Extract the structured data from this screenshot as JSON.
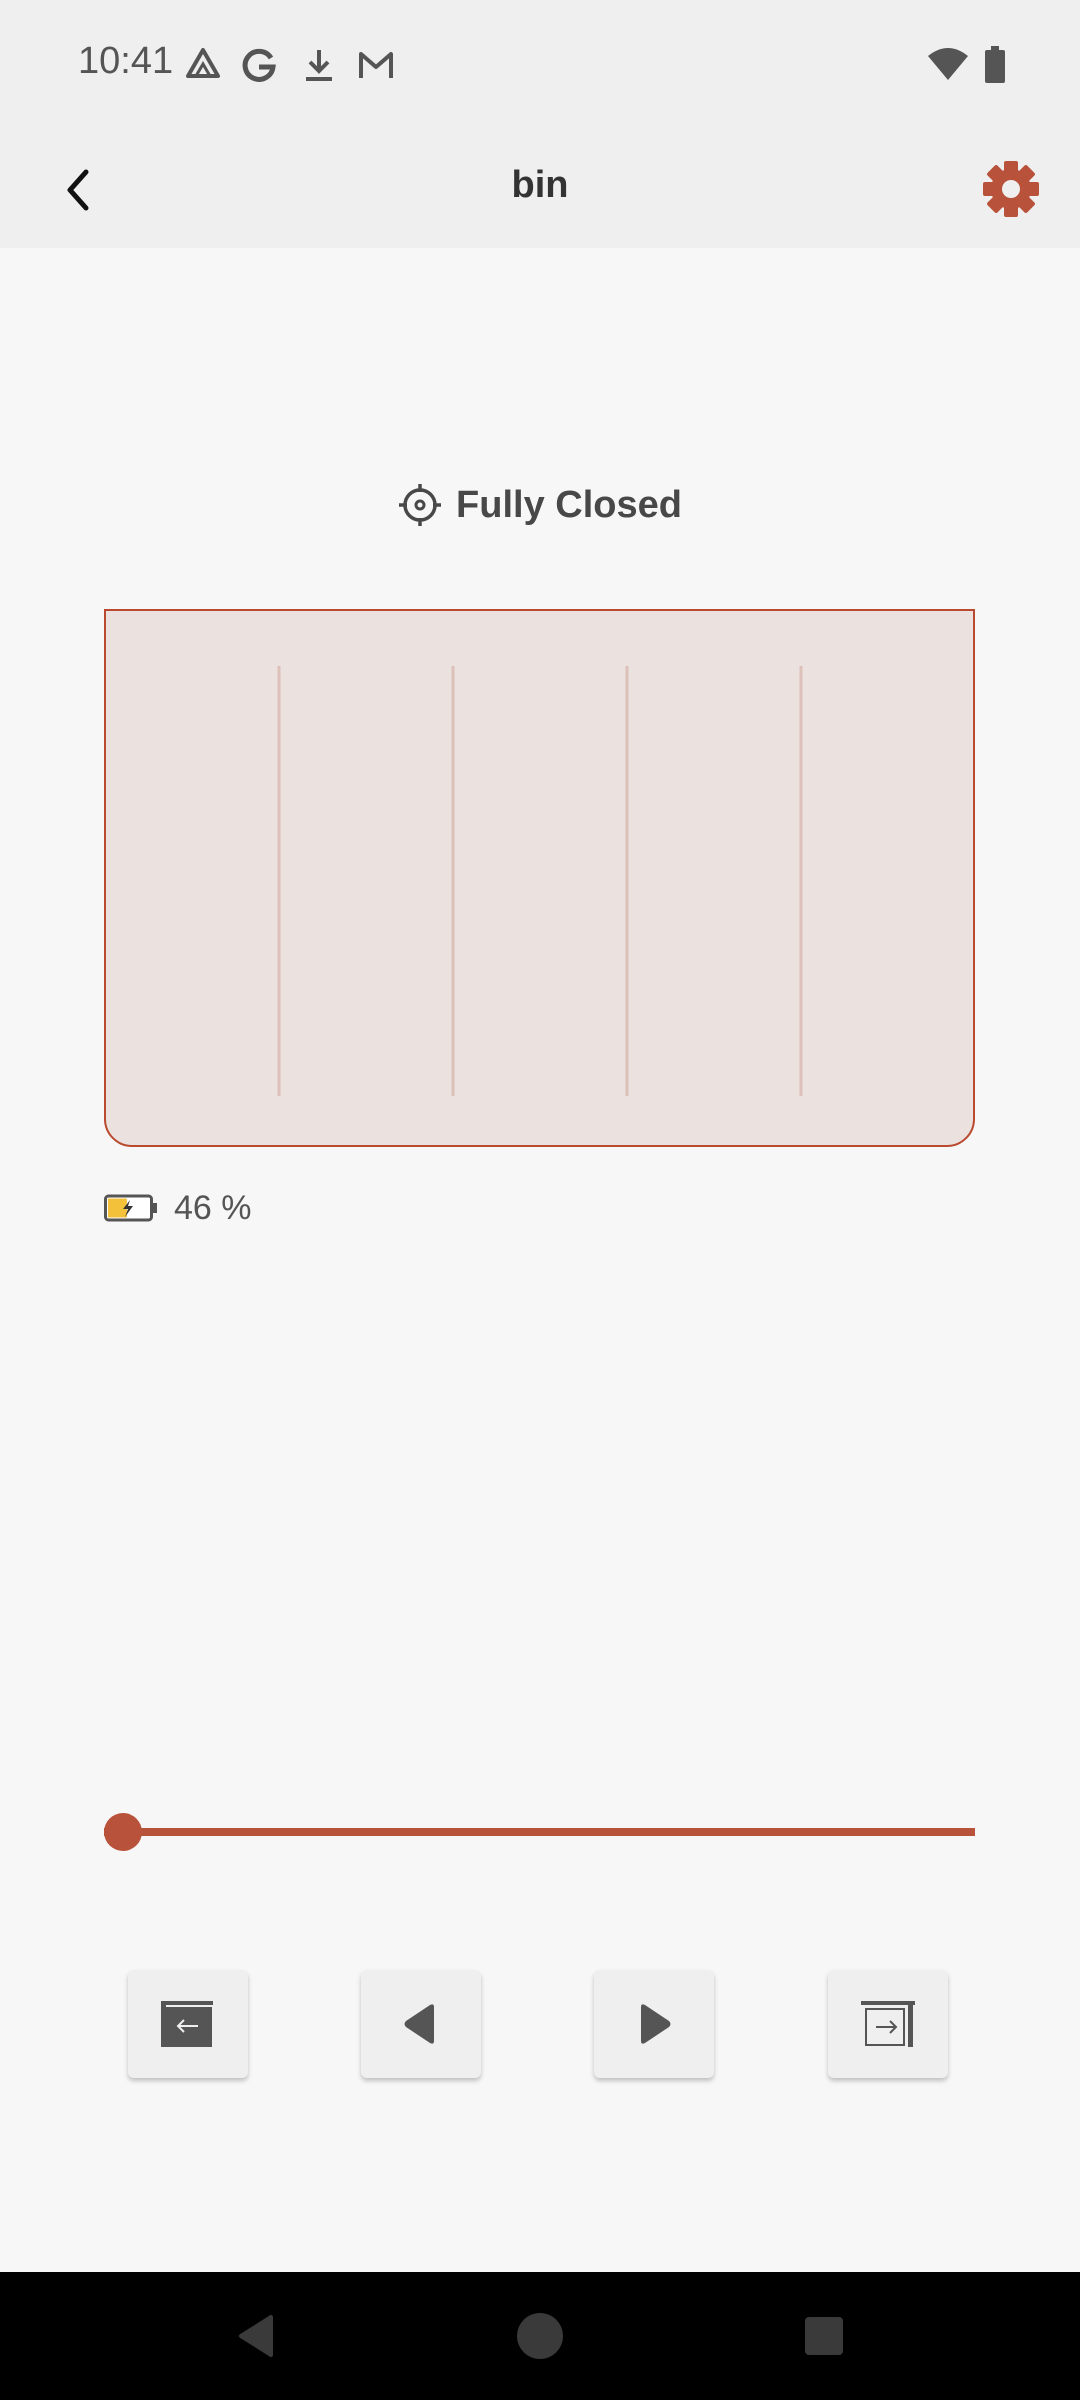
{
  "status_bar": {
    "time": "10:41",
    "notification_icons": [
      "drive-icon",
      "google-icon",
      "download-icon",
      "gmail-icon"
    ],
    "system_icons": [
      "wifi-icon",
      "battery-icon"
    ]
  },
  "app_bar": {
    "title": "bin",
    "back_icon": "back-arrow-icon",
    "settings_icon": "gear-icon",
    "accent_color": "#b9523a"
  },
  "device": {
    "state_icon": "position-target-icon",
    "state": "Fully Closed",
    "battery_icon": "battery-charging-icon",
    "battery_percent": 46,
    "battery_label": "46 %",
    "position_fraction": 0.0
  },
  "controls": [
    {
      "name": "fully-open-button",
      "icon": "curtain-open-left-icon"
    },
    {
      "name": "move-left-button",
      "icon": "triangle-left-icon"
    },
    {
      "name": "move-right-button",
      "icon": "triangle-right-icon"
    },
    {
      "name": "fully-close-button",
      "icon": "curtain-close-right-icon"
    }
  ],
  "nav_bar": {
    "items": [
      "nav-back-icon",
      "nav-home-icon",
      "nav-recents-icon"
    ]
  },
  "colors": {
    "accent": "#b9523a",
    "curtain_fill": "#ebe1de",
    "battery_fill": "#f4c23a"
  }
}
